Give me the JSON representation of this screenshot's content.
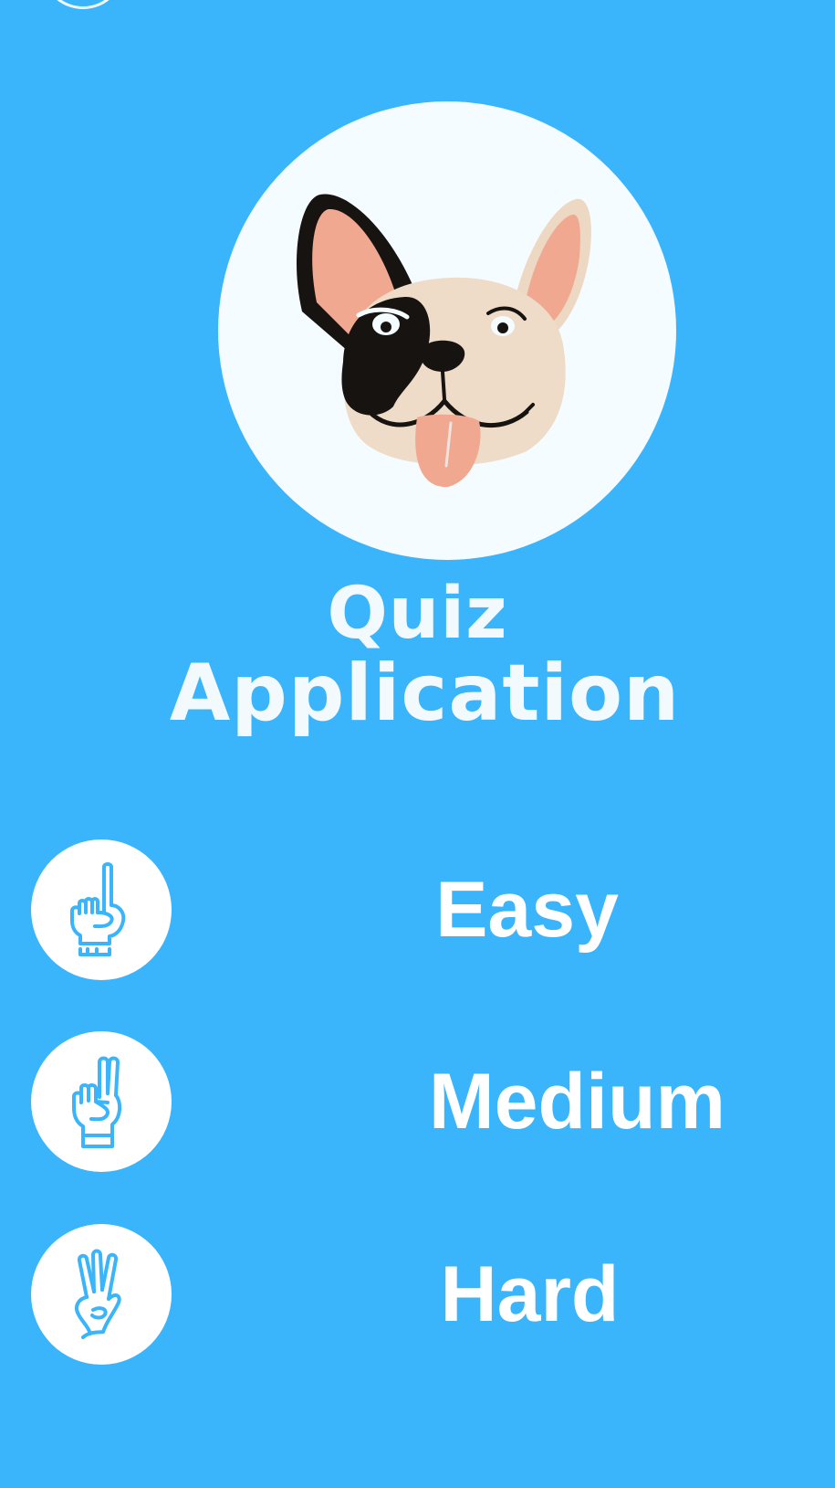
{
  "app": {
    "title_line_1": "Quiz",
    "title_line_2": "Application"
  },
  "logo": {
    "icon": "french-bulldog-face-logo"
  },
  "levels": [
    {
      "label": "Easy",
      "icon": "one-finger-hand-icon"
    },
    {
      "label": "Medium",
      "icon": "two-finger-hand-icon"
    },
    {
      "label": "Hard",
      "icon": "three-finger-hand-icon"
    }
  ],
  "colors": {
    "background": "#3AB4FB",
    "circle": "#FFFFFF",
    "icon_stroke": "#3AB4FB",
    "text": "#FFFFFF"
  }
}
